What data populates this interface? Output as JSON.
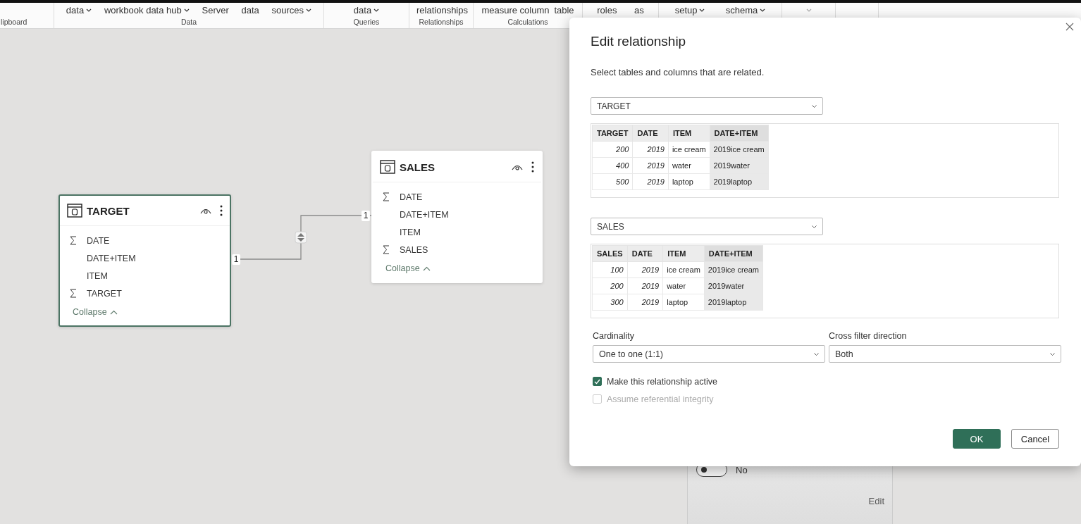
{
  "ribbon": {
    "groups": [
      {
        "label": "lipboard"
      },
      {
        "label": "Data",
        "items": [
          {
            "label": "data",
            "dropdown": true
          },
          {
            "label": "workbook data hub",
            "dropdown": true
          },
          {
            "label": "Server",
            "dropdown": false
          },
          {
            "label": "data",
            "dropdown": false
          },
          {
            "label": "sources",
            "dropdown": true
          }
        ]
      },
      {
        "label": "Queries",
        "items": [
          {
            "label": "data",
            "dropdown": true
          }
        ]
      },
      {
        "label": "Relationships",
        "items": [
          {
            "label": "relationships",
            "dropdown": false
          }
        ]
      },
      {
        "label": "Calculations",
        "items": [
          {
            "label": "measure column",
            "dropdown": false
          },
          {
            "label": "table",
            "dropdown": false
          }
        ]
      },
      {
        "items": [
          {
            "label": "roles",
            "dropdown": false
          },
          {
            "label": "as",
            "dropdown": false
          }
        ]
      },
      {
        "items": [
          {
            "label": "setup",
            "dropdown": true
          },
          {
            "label": "schema",
            "dropdown": true
          }
        ]
      },
      {
        "items": [
          {
            "dropdown": true
          }
        ]
      }
    ]
  },
  "model": {
    "tables": [
      {
        "title": "TARGET",
        "selected": true,
        "collapse": "Collapse",
        "fields": [
          {
            "name": "DATE",
            "kind": "sum"
          },
          {
            "name": "DATE+ITEM",
            "kind": "plain"
          },
          {
            "name": "ITEM",
            "kind": "plain"
          },
          {
            "name": "TARGET",
            "kind": "sum"
          }
        ]
      },
      {
        "title": "SALES",
        "selected": false,
        "collapse": "Collapse",
        "fields": [
          {
            "name": "DATE",
            "kind": "sum"
          },
          {
            "name": "DATE+ITEM",
            "kind": "plain"
          },
          {
            "name": "ITEM",
            "kind": "plain"
          },
          {
            "name": "SALES",
            "kind": "sum"
          }
        ]
      }
    ],
    "relationship": {
      "from_label": "1",
      "to_label": "1"
    }
  },
  "properties_panel": {
    "toggle": {
      "on": false,
      "label": "No"
    },
    "edit_link": "Edit"
  },
  "dialog": {
    "title": "Edit relationship",
    "subtitle": "Select tables and columns that are related.",
    "tables": [
      {
        "dropdown": "TARGET",
        "columns": [
          {
            "name": "TARGET",
            "kind": "number",
            "selected": false
          },
          {
            "name": "DATE",
            "kind": "number",
            "selected": false
          },
          {
            "name": "ITEM",
            "kind": "text",
            "selected": false
          },
          {
            "name": "DATE+ITEM",
            "kind": "text",
            "selected": true
          }
        ],
        "rows": [
          [
            "200",
            "2019",
            "ice cream",
            "2019ice cream"
          ],
          [
            "400",
            "2019",
            "water",
            "2019water"
          ],
          [
            "500",
            "2019",
            "laptop",
            "2019laptop"
          ]
        ]
      },
      {
        "dropdown": "SALES",
        "columns": [
          {
            "name": "SALES",
            "kind": "number",
            "selected": false
          },
          {
            "name": "DATE",
            "kind": "number",
            "selected": false
          },
          {
            "name": "ITEM",
            "kind": "text",
            "selected": false
          },
          {
            "name": "DATE+ITEM",
            "kind": "text",
            "selected": true
          }
        ],
        "rows": [
          [
            "100",
            "2019",
            "ice cream",
            "2019ice cream"
          ],
          [
            "200",
            "2019",
            "water",
            "2019water"
          ],
          [
            "300",
            "2019",
            "laptop",
            "2019laptop"
          ]
        ]
      }
    ],
    "cardinality": {
      "label": "Cardinality",
      "value": "One to one (1:1)"
    },
    "cross_filter": {
      "label": "Cross filter direction",
      "value": "Both"
    },
    "checkboxes": [
      {
        "label": "Make this relationship active",
        "checked": true,
        "disabled": false
      },
      {
        "label": "Assume referential integrity",
        "checked": false,
        "disabled": true
      }
    ],
    "buttons": [
      {
        "label": "OK",
        "kind": "primary"
      },
      {
        "label": "Cancel",
        "kind": "secondary"
      }
    ]
  }
}
